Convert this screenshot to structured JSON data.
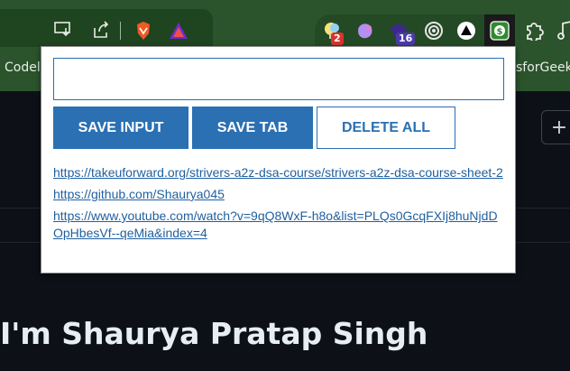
{
  "bookmarks": {
    "left_label": "Codel",
    "right_label": "sforGeek"
  },
  "extensions": {
    "badge_lightbulb": "2",
    "badge_hat": "16"
  },
  "page": {
    "plus_label": "+",
    "headline": "I'm Shaurya Pratap Singh"
  },
  "popup": {
    "input_value": "",
    "input_placeholder": "",
    "buttons": {
      "save_input": "SAVE INPUT",
      "save_tab": "SAVE TAB",
      "delete_all": "DELETE ALL"
    },
    "leads": [
      {
        "url": "https://takeuforward.org/strivers-a2z-dsa-course/strivers-a2z-dsa-course-sheet-2"
      },
      {
        "url": "https://github.com/Shaurya045"
      },
      {
        "url": "https://www.youtube.com/watch?v=9qQ8WxF-h8o&list=PLQs0GcqFXIj8huNjdDOpHbesVf--qeMia&index=4"
      }
    ]
  },
  "colors": {
    "accent": "#2a70b3",
    "toolbar": "#2b542c",
    "page_bg": "#0d1117"
  }
}
